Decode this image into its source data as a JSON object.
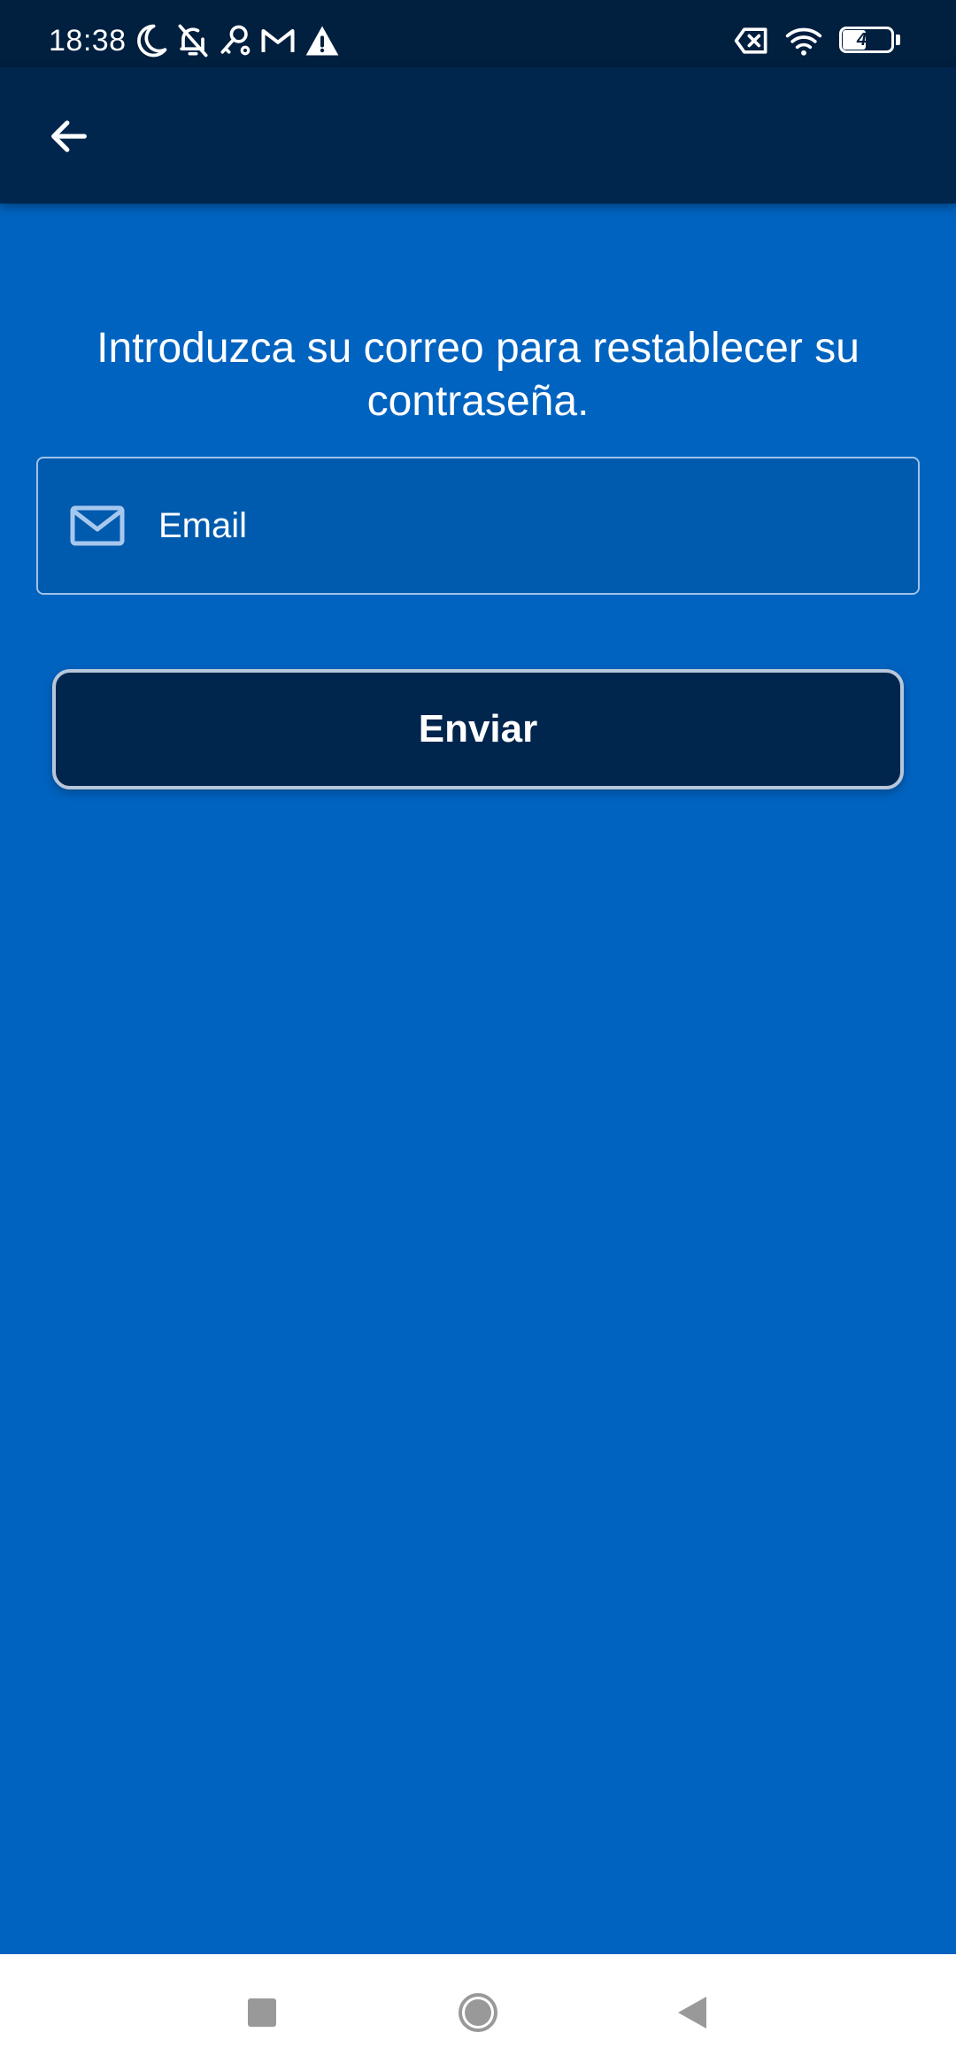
{
  "status_bar": {
    "time": "18:38",
    "battery_level": "49",
    "battery_fraction": 0.49,
    "left_icons": [
      "moon-icon",
      "bell-off-icon",
      "key-icon",
      "gmail-icon",
      "warning-icon"
    ],
    "right_icons": [
      "no-sim-icon",
      "wifi-icon",
      "battery-icon"
    ]
  },
  "app_bar": {
    "back_icon": "arrow-left-icon"
  },
  "form": {
    "instruction": "Introduzca su correo para restablecer su contraseña.",
    "email_placeholder": "Email",
    "email_value": "",
    "email_icon": "mail-icon",
    "submit_label": "Enviar"
  },
  "nav_bar": {
    "buttons": [
      "recents-button",
      "home-button",
      "back-button"
    ]
  },
  "colors": {
    "background": "#0063c0",
    "app_bar": "#00264d",
    "status_bar": "#011f3f",
    "field_border": "#9fc3ea",
    "button_border": "#b7c7da",
    "nav_icons": "#999999"
  }
}
